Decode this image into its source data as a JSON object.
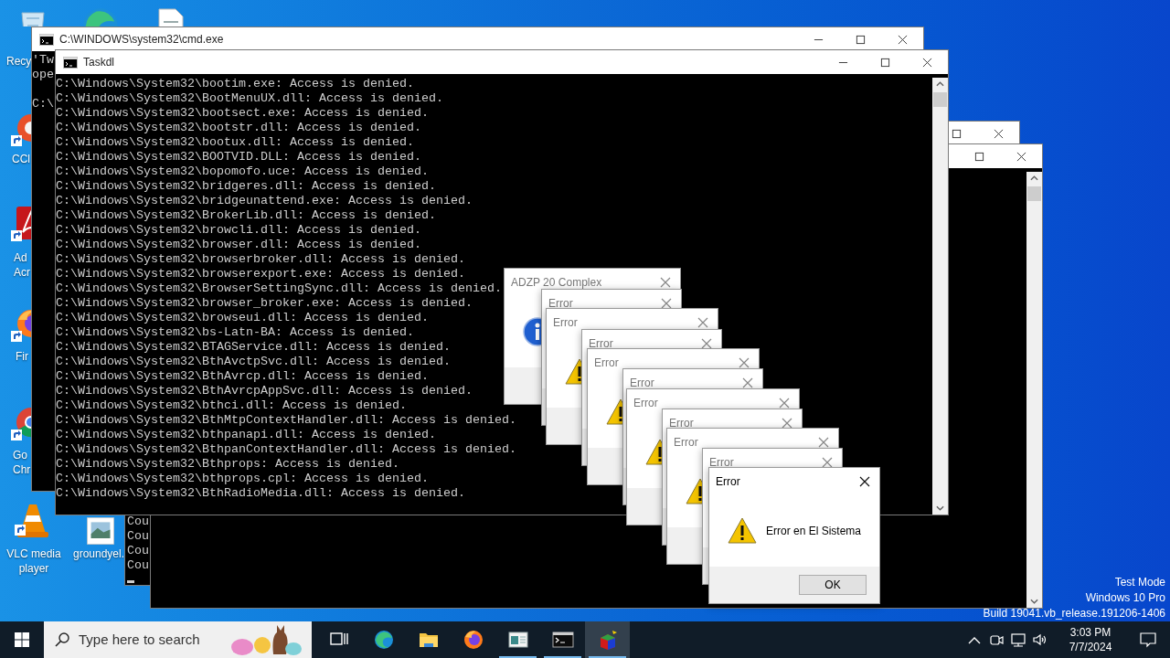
{
  "desktop_icons": [
    {
      "kind": "recycle-bin",
      "lines": [
        "Recy"
      ]
    },
    {
      "kind": "edge"
    },
    {
      "kind": "document"
    },
    {
      "kind": "ccleaner",
      "lines": [
        "CCl"
      ]
    },
    {
      "kind": "acrobat",
      "lines": [
        "Ad",
        "Acr"
      ]
    },
    {
      "kind": "firefox",
      "lines": [
        "Fir"
      ]
    },
    {
      "kind": "chrome",
      "lines": [
        "Go",
        "Chr"
      ]
    },
    {
      "kind": "vlc",
      "lines": [
        "VLC media",
        "player"
      ]
    },
    {
      "kind": "image",
      "lines": [
        "groundyel."
      ]
    }
  ],
  "back_console": {
    "lines": [
      "Cou",
      "Cou",
      "Cou",
      "Cou"
    ]
  },
  "cmd_window": {
    "title": "C:\\WINDOWS\\system32\\cmd.exe",
    "lines": [
      "'Tw",
      "ope"
    ],
    "prompt": "C:\\"
  },
  "taskdl_window": {
    "title": "Taskdl",
    "lines": [
      "C:\\Windows\\System32\\bootim.exe: Access is denied.",
      "C:\\Windows\\System32\\BootMenuUX.dll: Access is denied.",
      "C:\\Windows\\System32\\bootsect.exe: Access is denied.",
      "C:\\Windows\\System32\\bootstr.dll: Access is denied.",
      "C:\\Windows\\System32\\bootux.dll: Access is denied.",
      "C:\\Windows\\System32\\BOOTVID.DLL: Access is denied.",
      "C:\\Windows\\System32\\bopomofo.uce: Access is denied.",
      "C:\\Windows\\System32\\bridgeres.dll: Access is denied.",
      "C:\\Windows\\System32\\bridgeunattend.exe: Access is denied.",
      "C:\\Windows\\System32\\BrokerLib.dll: Access is denied.",
      "C:\\Windows\\System32\\browcli.dll: Access is denied.",
      "C:\\Windows\\System32\\browser.dll: Access is denied.",
      "C:\\Windows\\System32\\browserbroker.dll: Access is denied.",
      "C:\\Windows\\System32\\browserexport.exe: Access is denied.",
      "C:\\Windows\\System32\\BrowserSettingSync.dll: Access is denied.",
      "C:\\Windows\\System32\\browser_broker.exe: Access is denied.",
      "C:\\Windows\\System32\\browseui.dll: Access is denied.",
      "C:\\Windows\\System32\\bs-Latn-BA: Access is denied.",
      "C:\\Windows\\System32\\BTAGService.dll: Access is denied.",
      "C:\\Windows\\System32\\BthAvctpSvc.dll: Access is denied.",
      "C:\\Windows\\System32\\BthAvrcp.dll: Access is denied.",
      "C:\\Windows\\System32\\BthAvrcpAppSvc.dll: Access is denied.",
      "C:\\Windows\\System32\\bthci.dll: Access is denied.",
      "C:\\Windows\\System32\\BthMtpContextHandler.dll: Access is denied.",
      "C:\\Windows\\System32\\bthpanapi.dll: Access is denied.",
      "C:\\Windows\\System32\\BthpanContextHandler.dll: Access is denied.",
      "C:\\Windows\\System32\\Bthprops: Access is denied.",
      "C:\\Windows\\System32\\bthprops.cpl: Access is denied.",
      "C:\\Windows\\System32\\BthRadioMedia.dll: Access is denied."
    ]
  },
  "dialogs": [
    {
      "title": "ADZP 20 Complex",
      "kind": "info"
    },
    {
      "title": "Error",
      "kind": "warning"
    },
    {
      "title": "Error",
      "kind": "warning"
    },
    {
      "title": "Error",
      "kind": "warning"
    },
    {
      "title": "Error",
      "kind": "warning"
    },
    {
      "title": "Error",
      "kind": "warning"
    },
    {
      "title": "Error",
      "kind": "warning"
    },
    {
      "title": "Error",
      "kind": "warning"
    },
    {
      "title": "Error",
      "kind": "warning"
    },
    {
      "title": "Error",
      "kind": "warning"
    },
    {
      "title": "Error",
      "kind": "warning",
      "message": "Error en El Sistema",
      "button": "OK"
    }
  ],
  "os_watermark": [
    "Test Mode",
    "Windows 10 Pro",
    "Build 19041.vb_release.191206-1406"
  ],
  "taskbar": {
    "search_placeholder": "Type here to search",
    "apps": [
      {
        "kind": "task-view",
        "running": false,
        "selected": false
      },
      {
        "kind": "edge",
        "running": false,
        "selected": false
      },
      {
        "kind": "folder",
        "running": false,
        "selected": false
      },
      {
        "kind": "firefox",
        "running": false,
        "selected": false
      },
      {
        "kind": "window",
        "running": true,
        "selected": false
      },
      {
        "kind": "console",
        "running": true,
        "selected": false
      },
      {
        "kind": "cube",
        "running": true,
        "selected": true
      }
    ],
    "time": "3:03 PM",
    "date": "7/7/2024"
  }
}
